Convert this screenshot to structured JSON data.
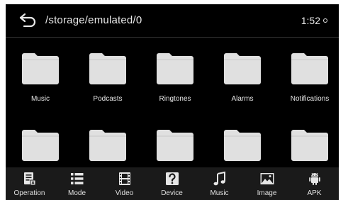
{
  "header": {
    "path": "/storage/emulated/0",
    "time": "1:52"
  },
  "folders": [
    {
      "label": "Music"
    },
    {
      "label": "Podcasts"
    },
    {
      "label": "Ringtones"
    },
    {
      "label": "Alarms"
    },
    {
      "label": "Notifications"
    },
    {
      "label": ""
    },
    {
      "label": ""
    },
    {
      "label": ""
    },
    {
      "label": ""
    },
    {
      "label": ""
    }
  ],
  "bottom_nav": [
    {
      "label": "Operation",
      "icon": "operation-icon"
    },
    {
      "label": "Mode",
      "icon": "list-icon"
    },
    {
      "label": "Video",
      "icon": "film-icon"
    },
    {
      "label": "Device",
      "icon": "question-icon"
    },
    {
      "label": "Music",
      "icon": "music-note-icon"
    },
    {
      "label": "Image",
      "icon": "image-icon"
    },
    {
      "label": "APK",
      "icon": "android-icon"
    }
  ],
  "colors": {
    "background": "#000000",
    "folder": "#e0e0e0",
    "bottom_bar": "#1a1a1a"
  }
}
